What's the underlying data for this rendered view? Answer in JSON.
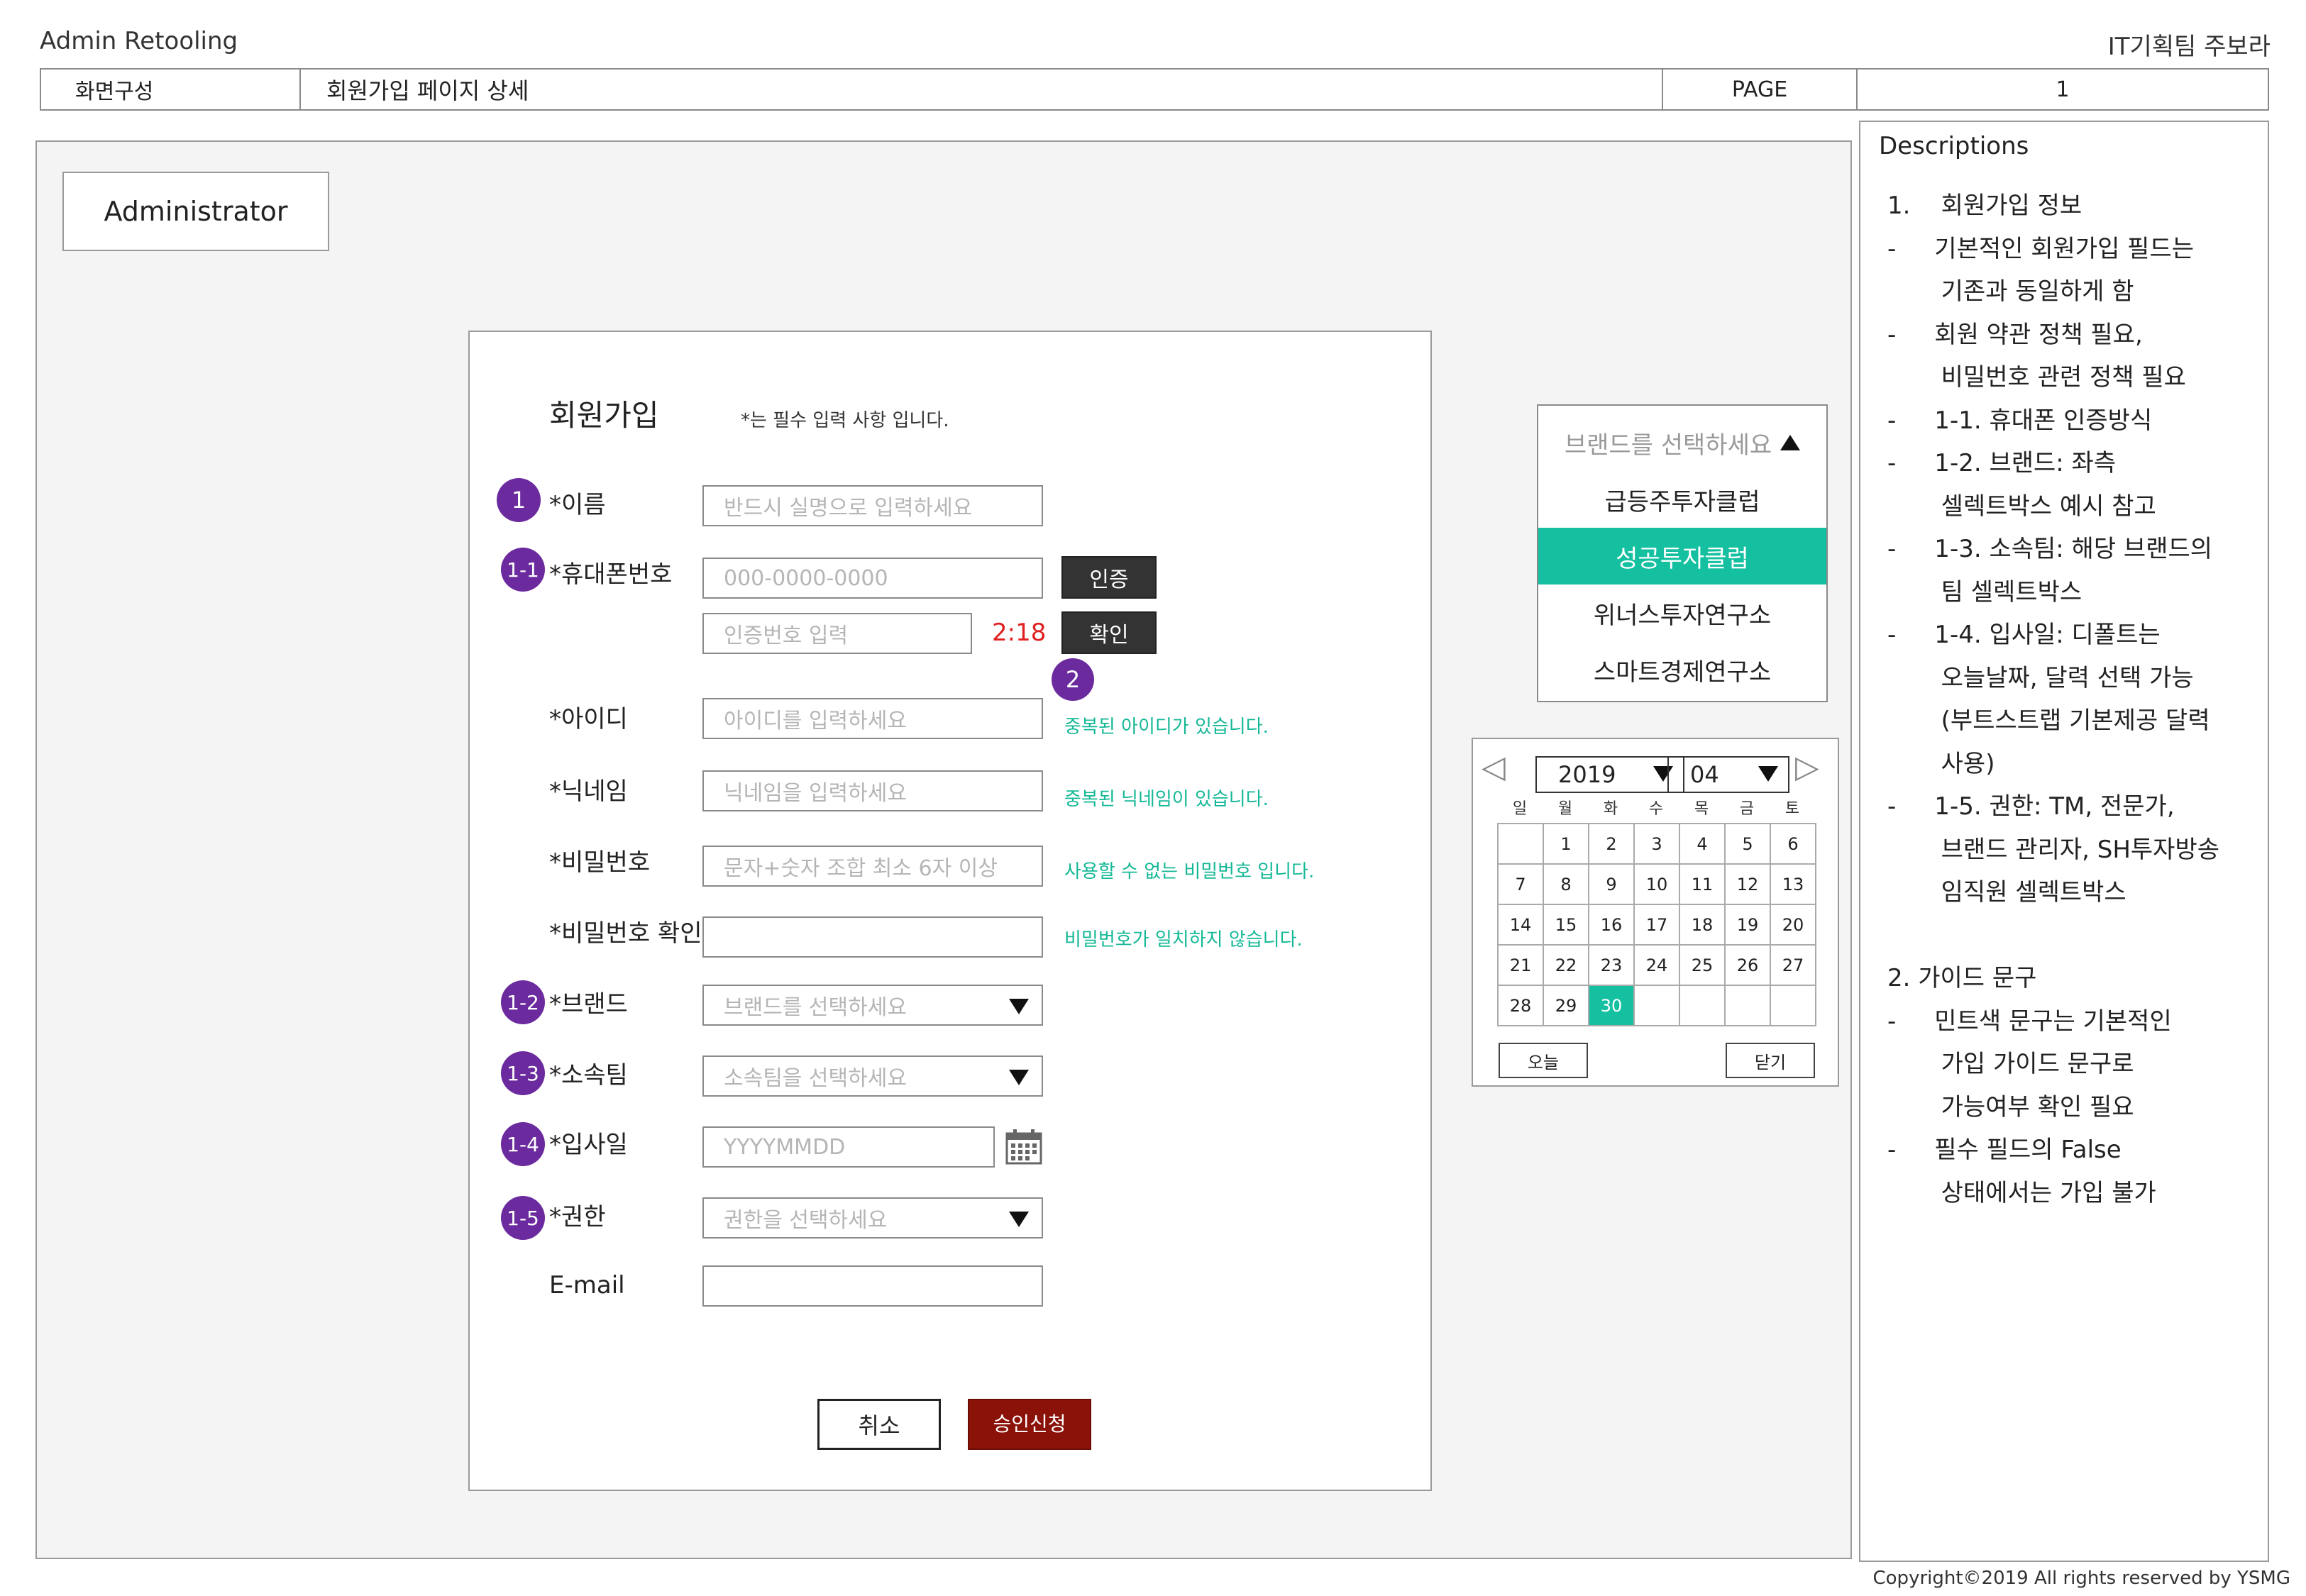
{
  "header": {
    "app_title": "Admin Retooling",
    "author": "IT기획팀 주보라",
    "screen_label": "화면구성",
    "screen_name": "회원가입 페이지 상세",
    "page_label": "PAGE",
    "page_number": "1"
  },
  "admin_label": "Administrator",
  "form": {
    "title": "회원가입",
    "required_note": "*는 필수 입력 사항 입니다.",
    "name": {
      "label": "*이름",
      "placeholder": "반드시 실명으로 입력하세요",
      "badge": "1"
    },
    "phone": {
      "label": "*휴대폰번호",
      "placeholder": "000-0000-0000",
      "badge": "1-1",
      "auth_button": "인증",
      "code_placeholder": "인증번호 입력",
      "timer": "2:18",
      "confirm_button": "확인"
    },
    "guide_badge": "2",
    "user_id": {
      "label": "*아이디",
      "placeholder": "아이디를 입력하세요",
      "message": "중복된 아이디가 있습니다."
    },
    "nickname": {
      "label": "*닉네임",
      "placeholder": "닉네임을 입력하세요",
      "message": "중복된 닉네임이 있습니다."
    },
    "password": {
      "label": "*비밀번호",
      "placeholder": "문자+숫자 조합 최소 6자 이상",
      "message": "사용할 수 없는 비밀번호 입니다."
    },
    "password_confirm": {
      "label": "*비밀번호 확인",
      "message": "비밀번호가 일치하지 않습니다."
    },
    "brand": {
      "label": "*브랜드",
      "placeholder": "브랜드를 선택하세요",
      "badge": "1-2"
    },
    "team": {
      "label": "*소속팀",
      "placeholder": "소속팀을 선택하세요",
      "badge": "1-3"
    },
    "join_date": {
      "label": "*입사일",
      "placeholder": "YYYYMMDD",
      "badge": "1-4"
    },
    "role": {
      "label": "*권한",
      "placeholder": "권한을 선택하세요",
      "badge": "1-5"
    },
    "email": {
      "label": "E-mail"
    },
    "cancel_button": "취소",
    "submit_button": "승인신청"
  },
  "brand_dropdown": {
    "header": "브랜드를 선택하세요",
    "options": [
      "급등주투자클럽",
      "성공투자클럽",
      "위너스투자연구소",
      "스마트경제연구소"
    ],
    "selected": "성공투자클럽"
  },
  "calendar": {
    "year": "2019",
    "month": "04",
    "weekdays": [
      "일",
      "월",
      "화",
      "수",
      "목",
      "금",
      "토"
    ],
    "days": [
      "",
      "1",
      "2",
      "3",
      "4",
      "5",
      "6",
      "7",
      "8",
      "9",
      "10",
      "11",
      "12",
      "13",
      "14",
      "15",
      "16",
      "17",
      "18",
      "19",
      "20",
      "21",
      "22",
      "23",
      "24",
      "25",
      "26",
      "27",
      "28",
      "29",
      "30",
      "",
      "",
      "",
      ""
    ],
    "selected_day": "30",
    "today_button": "오늘",
    "close_button": "닫기"
  },
  "descriptions": {
    "title": "Descriptions",
    "lines": [
      "1.    회원가입 정보",
      "-     기본적인 회원가입 필드는",
      "       기존과 동일하게 함",
      "-     회원 약관 정책 필요,",
      "       비밀번호 관련 정책 필요",
      "-     1-1. 휴대폰 인증방식",
      "-     1-2. 브랜드: 좌측",
      "       셀렉트박스 예시 참고",
      "-     1-3. 소속팀: 해당 브랜드의",
      "       팀 셀렉트박스",
      "-     1-4. 입사일: 디폴트는",
      "       오늘날짜, 달력 선택 가능",
      "       (부트스트랩 기본제공 달력",
      "       사용)",
      "-     1-5. 권한: TM, 전문가,",
      "       브랜드 관리자, SH투자방송",
      "       임직원 셀렉트박스",
      "",
      "2. 가이드 문구",
      "-     민트색 문구는 기본적인",
      "       가입 가이드 문구로",
      "       가능여부 확인 필요",
      "-     필수 필드의 False",
      "       상태에서는 가입 불가"
    ]
  },
  "copyright": "Copyright©2019 All rights reserved by YSMG",
  "colors": {
    "mint": "#14c0a0",
    "badge": "#6b2a9e",
    "submit": "#8a1208",
    "timer": "#e02020"
  }
}
